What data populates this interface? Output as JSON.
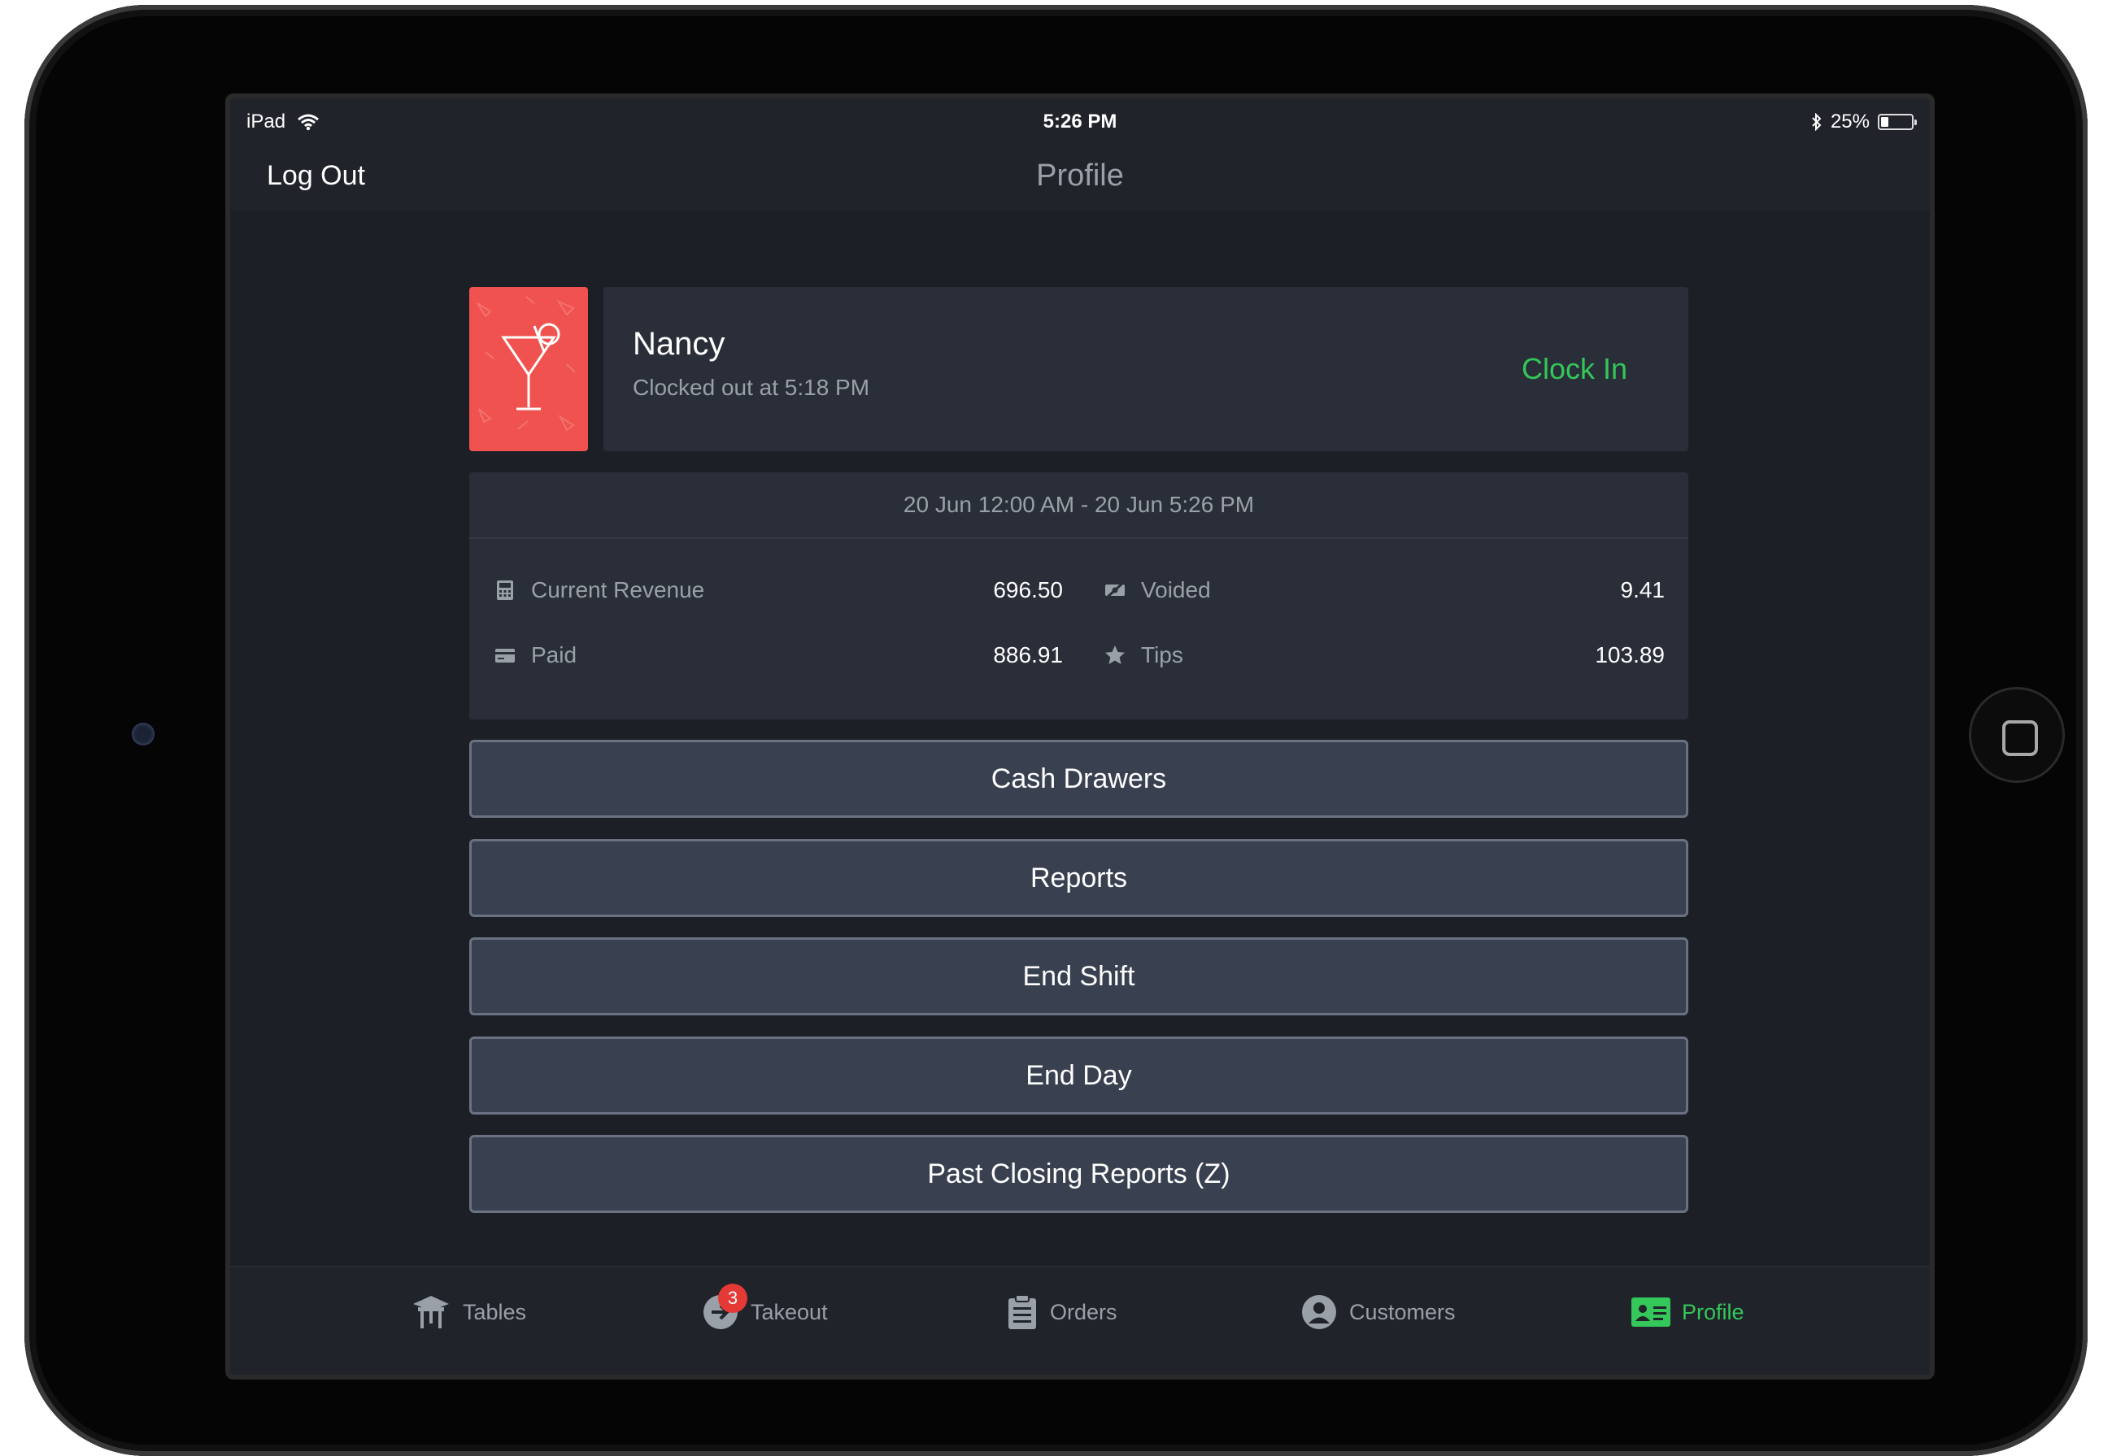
{
  "status_bar": {
    "device": "iPad",
    "time": "5:26 PM",
    "battery": "25%",
    "battery_level": 0.25
  },
  "nav": {
    "logout": "Log Out",
    "title": "Profile"
  },
  "profile": {
    "name": "Nancy",
    "status": "Clocked out at 5:18 PM",
    "clock_in": "Clock In",
    "avatar_color": "#f0534f"
  },
  "stats": {
    "range": "20 Jun 12:00 AM - 20 Jun 5:26 PM",
    "current_revenue": {
      "label": "Current Revenue",
      "value": "696.50"
    },
    "voided": {
      "label": "Voided",
      "value": "9.41"
    },
    "paid": {
      "label": "Paid",
      "value": "886.91"
    },
    "tips": {
      "label": "Tips",
      "value": "103.89"
    }
  },
  "buttons": {
    "cash_drawers": "Cash Drawers",
    "reports": "Reports",
    "end_shift": "End Shift",
    "end_day": "End Day",
    "past_closing": "Past Closing Reports (Z)"
  },
  "tabs": {
    "tables": "Tables",
    "takeout": "Takeout",
    "takeout_badge": "3",
    "orders": "Orders",
    "customers": "Customers",
    "profile": "Profile"
  },
  "colors": {
    "accent_green": "#34c759",
    "badge_red": "#e53935",
    "background": "#1c1f26"
  }
}
